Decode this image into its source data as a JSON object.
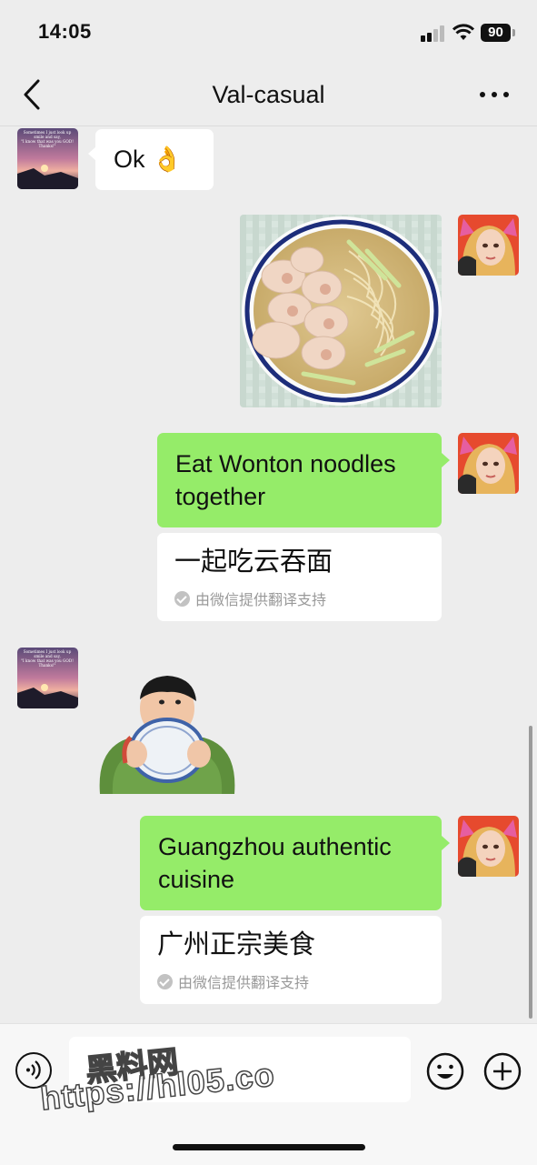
{
  "status_bar": {
    "time": "14:05",
    "battery": "90"
  },
  "nav": {
    "title": "Val-casual"
  },
  "messages": [
    {
      "side": "left",
      "type": "text",
      "text": "Ok 👌"
    },
    {
      "side": "right",
      "type": "image",
      "image_subject": "wonton-noodle-soup"
    },
    {
      "side": "right",
      "type": "text",
      "text_line1": "Eat Wonton noodles",
      "text_line2": "together",
      "translation": "一起吃云吞面",
      "translation_note": "由微信提供翻译支持"
    },
    {
      "side": "left",
      "type": "sticker",
      "image_subject": "child-drinking-from-bowl"
    },
    {
      "side": "right",
      "type": "text",
      "text_line1": "Guangzhou authentic",
      "text_line2": "cuisine",
      "translation": "广州正宗美食",
      "translation_note": "由微信提供翻译支持"
    }
  ],
  "avatar_left": {
    "caption_line1": "Sometimes I just look up",
    "caption_line2": "smile and say,",
    "caption_line3": "\"I know that was you GOD!",
    "caption_line4": "Thanks!\""
  },
  "watermark": {
    "line1": "黑料网",
    "line2": "https://hl05.co"
  },
  "icons": [
    "back-chevron-icon",
    "more-dots-icon",
    "voice-icon",
    "emoji-icon",
    "plus-icon",
    "check-icon"
  ],
  "colors": {
    "background": "#ededed",
    "sent_bubble": "#95ec69",
    "received_bubble": "#ffffff"
  }
}
